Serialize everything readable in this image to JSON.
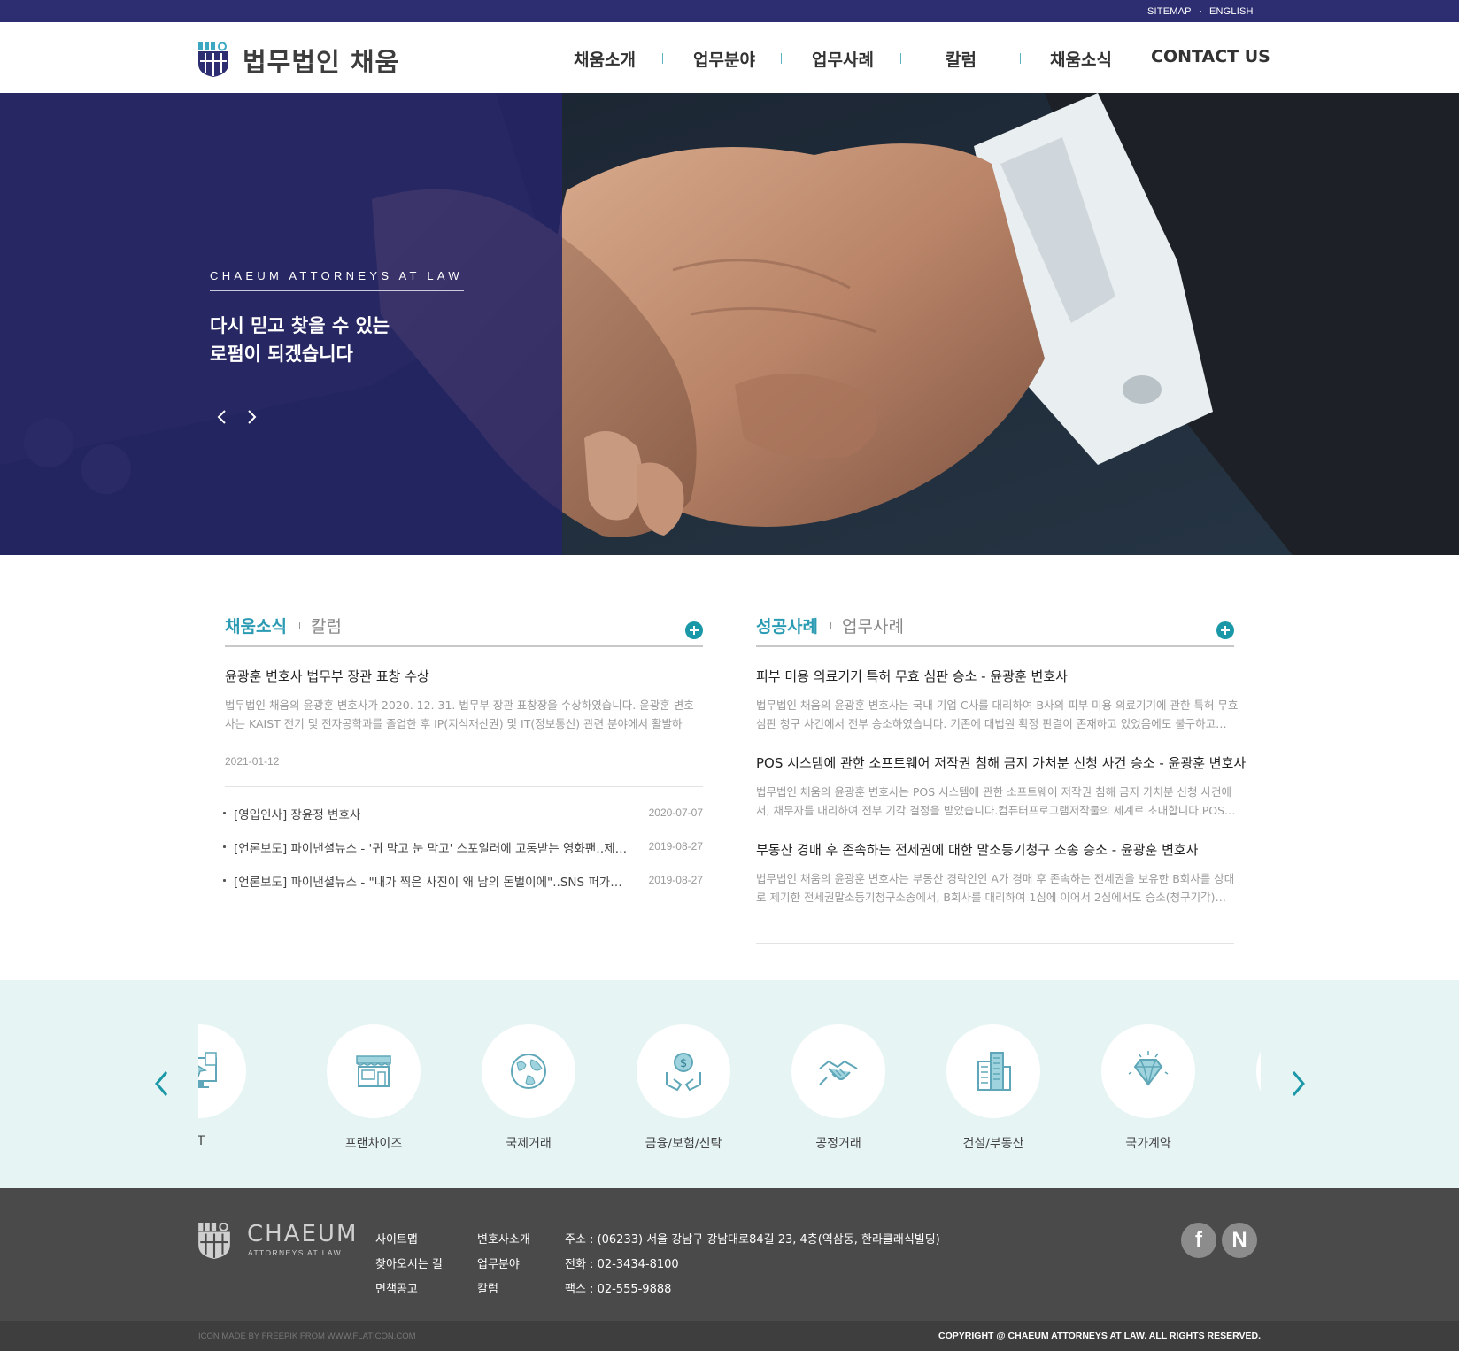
{
  "topbar": {
    "sitemap": "SITEMAP",
    "english": "ENGLISH"
  },
  "header": {
    "logo_text": "법무법인 채움",
    "nav": [
      "채움소개",
      "업무분야",
      "업무사례",
      "칼럼",
      "채움소식",
      "CONTACT US"
    ]
  },
  "hero": {
    "kicker": "CHAEUM ATTORNEYS AT LAW",
    "title_line1": "다시 믿고 찾을 수 있는",
    "title_line2": "로펌이 되겠습니다",
    "prev_icon": "chevron-left-icon",
    "next_icon": "chevron-right-icon"
  },
  "news_left": {
    "tab_active": "채움소식",
    "tab_other": "칼럼",
    "featured": {
      "title": "윤광훈 변호사 법무부 장관 표창 수상",
      "body": "법무법인 채움의 윤광훈 변호사가 2020. 12. 31. 법무부 장관 표창장을 수상하였습니다. 윤광훈 변호사는 KAIST 전기 및 전자공학과를 졸업한 후 IP(지식재산권) 및 IT(정보통신) 관련 분야에서 활발하게…",
      "date": "2021-01-12"
    },
    "list": [
      {
        "text": "[영입인사] 장윤정 변호사",
        "date": "2020-07-07"
      },
      {
        "text": "[언론보도] 파이낸셜뉴스 - '귀 막고 눈 막고' 스포일러에 고통받는 영화팬‥제…",
        "date": "2019-08-27"
      },
      {
        "text": "[언론보도] 파이낸셜뉴스 - \"내가 찍은 사진이 왜 남의 돈벌이에\"..SNS 퍼가기 …",
        "date": "2019-08-27"
      }
    ]
  },
  "news_right": {
    "tab_active": "성공사례",
    "tab_other": "업무사례",
    "articles": [
      {
        "title": "피부 미용 의료기기 특허 무효 심판 승소 - 윤광훈 변호사",
        "body": "법무법인 채움의 윤광훈 변호사는 국내 기업 C사를 대리하여 B사의 피부 미용 의료기기에 관한 특허 무효 심판 청구 사건에서 전부 승소하였습니다. 기존에 대법원 확정 판결이 존재하고 있었음에도 불구하고…"
      },
      {
        "title": "POS 시스템에 관한 소프트웨어 저작권 침해 금지 가처분 신청 사건 승소 - 윤광훈 변호사",
        "body": "법무법인 채움의 윤광훈 변호사는 POS 시스템에 관한 소프트웨어 저작권 침해 금지 가처분 신청 사건에서, 채무자를 대리하여 전부 기각 결정을 받았습니다.컴퓨터프로그램저작물의 세계로 초대합니다.POS…"
      },
      {
        "title": "부동산 경매 후 존속하는 전세권에 대한 말소등기청구 소송 승소 - 윤광훈 변호사",
        "body": "법무법인 채움의 윤광훈 변호사는 부동산 경락인인 A가 경매 후 존속하는 전세권을 보유한 B회사를 상대로 제기한 전세권말소등기청구소송에서, B회사를 대리하여 1심에 이어서 2심에서도 승소(청구기각)…"
      }
    ]
  },
  "practice": {
    "items": [
      {
        "label": "IT",
        "icon": "computer-icon"
      },
      {
        "label": "프랜차이즈",
        "icon": "storefront-icon"
      },
      {
        "label": "국제거래",
        "icon": "globe-icon"
      },
      {
        "label": "금융/보험/신탁",
        "icon": "money-hands-icon"
      },
      {
        "label": "공정거래",
        "icon": "handshake-icon"
      },
      {
        "label": "건설/부동산",
        "icon": "buildings-icon"
      },
      {
        "label": "국가계약",
        "icon": "diamond-icon"
      }
    ],
    "accent": "#1b98a8"
  },
  "footer": {
    "brand": "CHAEUM",
    "brand_sub": "ATTORNEYS AT LAW",
    "links_col1": [
      "사이트맵",
      "찾아오시는 길",
      "면책공고"
    ],
    "links_col2": [
      "변호사소개",
      "업무분야",
      "칼럼"
    ],
    "address": "주소 : (06233) 서울 강남구 강남대로84길 23, 4층(역삼동, 한라클래식빌딩)",
    "phone": "전화 : 02-3434-8100",
    "fax": "팩스 : 02-555-9888",
    "sns": [
      {
        "icon": "facebook-icon",
        "glyph": "f"
      },
      {
        "icon": "naver-icon",
        "glyph": "N"
      }
    ],
    "icon_credit": "ICON MADE BY FREEPIK FROM WWW.FLATICON.COM",
    "copyright": "COPYRIGHT @ CHAEUM ATTORNEYS AT LAW. ALL RIGHTS RESERVED."
  },
  "colors": {
    "nav_bar": "#2d2d72",
    "accent_teal": "#2a9bb3",
    "practice_bg": "#e6f4f4",
    "footer_bg": "#4a4a4a"
  }
}
